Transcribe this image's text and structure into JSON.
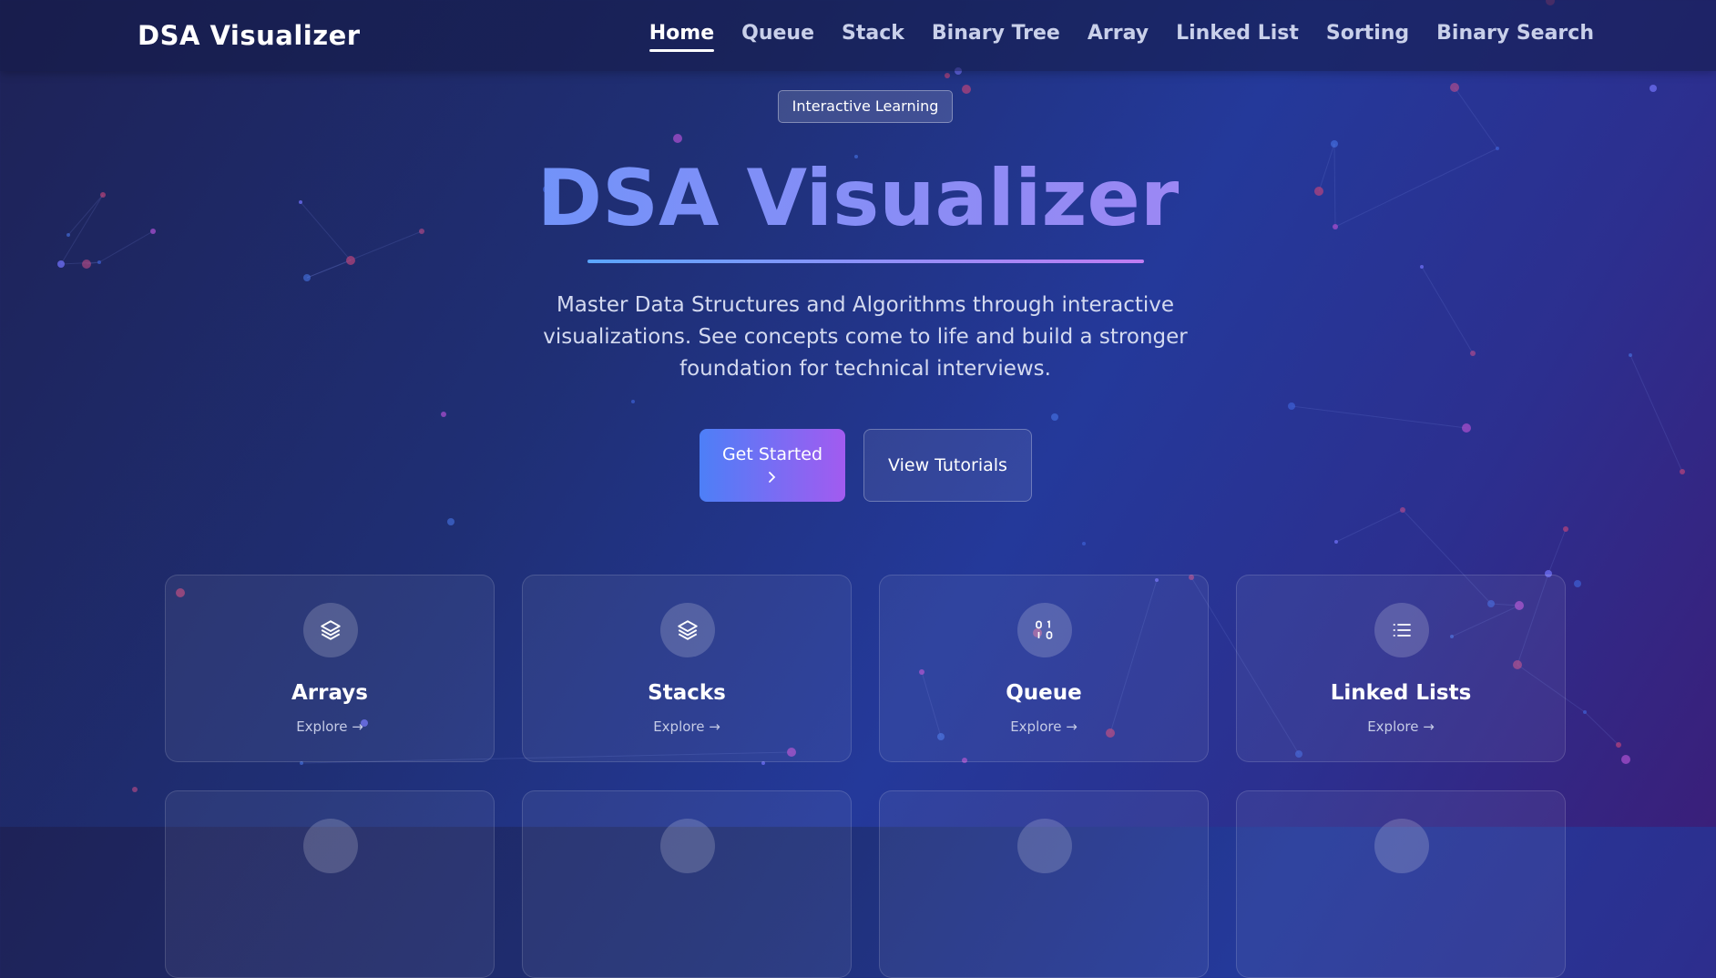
{
  "nav": {
    "brand": "DSA Visualizer",
    "links": [
      "Home",
      "Queue",
      "Stack",
      "Binary Tree",
      "Array",
      "Linked List",
      "Sorting",
      "Binary Search"
    ],
    "active": "Home"
  },
  "hero": {
    "badge": "Interactive Learning",
    "title": "DSA Visualizer",
    "description": "Master Data Structures and Algorithms through interactive visualizations. See concepts come to life and build a stronger foundation for technical interviews.",
    "primary_button": "Get Started",
    "primary_button_icon": "chevron-right-icon",
    "secondary_button": "View Tutorials"
  },
  "cards": [
    {
      "title": "Arrays",
      "link": "Explore →",
      "icon": "layers-icon"
    },
    {
      "title": "Stacks",
      "link": "Explore →",
      "icon": "layers-icon"
    },
    {
      "title": "Queue",
      "link": "Explore →",
      "icon": "binary-icon"
    },
    {
      "title": "Linked Lists",
      "link": "Explore →",
      "icon": "list-icon"
    }
  ],
  "colors": {
    "accent_start": "#4d7ff7",
    "accent_end": "#a25bf0",
    "title_gradient_start": "#4f9cff",
    "title_gradient_end": "#c07cf2"
  }
}
